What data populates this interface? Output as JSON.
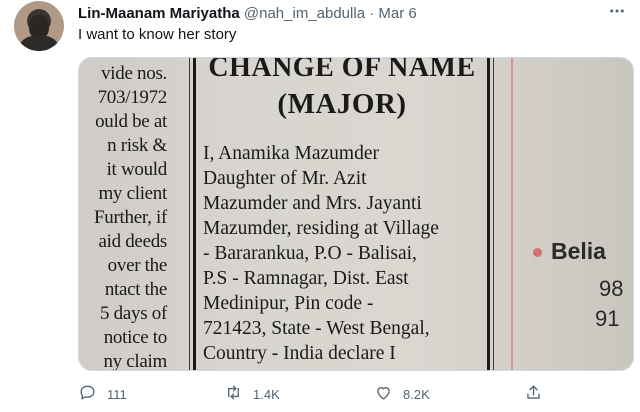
{
  "tweet": {
    "display_name": "Lin-Maanam Mariyatha",
    "handle": "@nah_im_abdulla",
    "separator": "·",
    "date": "Mar 6",
    "text": "I want to know her story",
    "more_icon": "more-horizontal-icon"
  },
  "media": {
    "left_clipping_lines": [
      "vide nos.",
      "703/1972",
      "ould be at",
      "n risk &",
      "it would",
      "my client",
      "Further, if",
      "aid deeds",
      "over the",
      "ntact the",
      "5 days of",
      "notice to",
      "ny claim"
    ],
    "ad_title_line1": "CHANGE OF NAME",
    "ad_title_line2": "(MAJOR)",
    "ad_body_lines": [
      "I, Anamika Mazumder",
      "Daughter of Mr. Azit",
      "Mazumder and Mrs. Jayanti",
      "Mazumder, residing at Village",
      "- Bararankua, P.O - Balisai,",
      "P.S - Ramnagar, Dist. East",
      "Medinipur, Pin code -",
      "721423, State - West Bengal,",
      "Country - India declare I"
    ],
    "right_col_word": "Belia",
    "right_col_num1": "98",
    "right_col_num2": "91"
  },
  "actions": {
    "reply_count": "111",
    "retweet_count": "1.4K",
    "like_count": "8.2K"
  },
  "colors": {
    "text_primary": "#0f1419",
    "text_secondary": "#536471",
    "border": "#cfd9de"
  }
}
